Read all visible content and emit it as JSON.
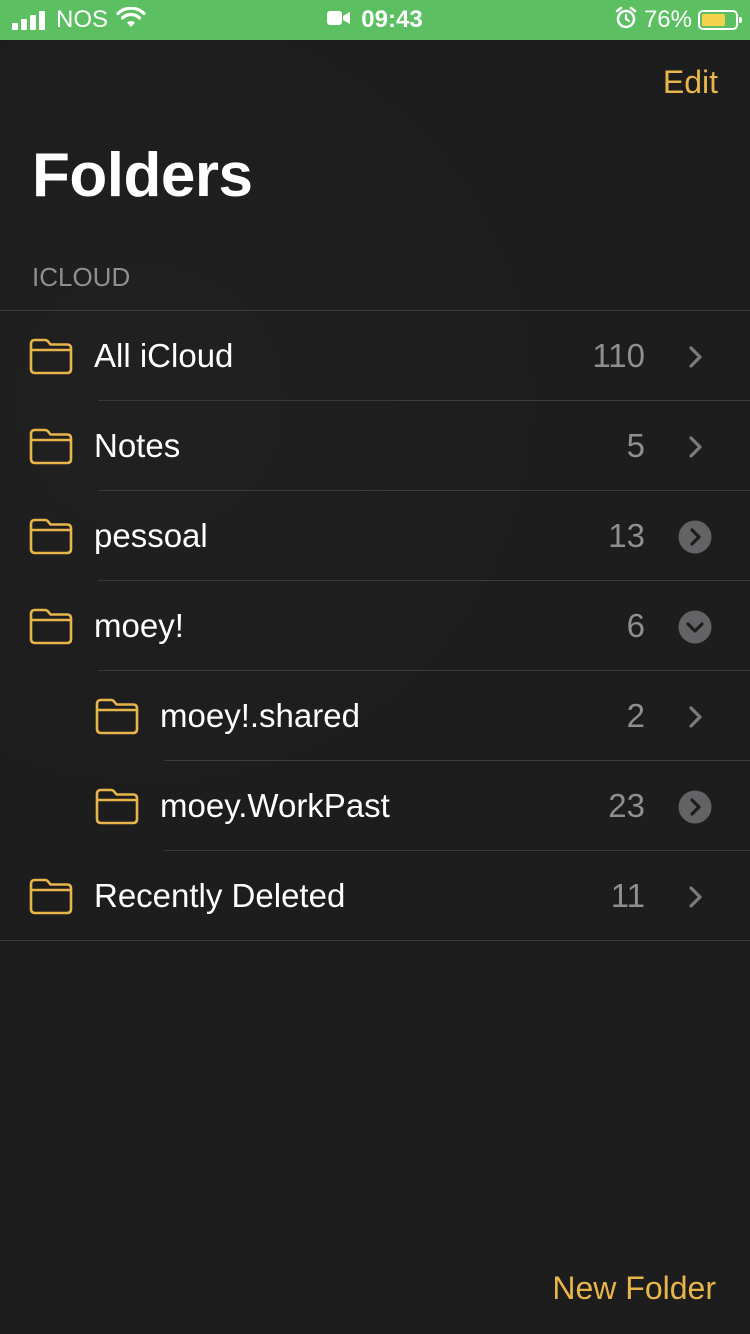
{
  "status_bar": {
    "carrier": "NOS",
    "time": "09:43",
    "battery_percent": "76%",
    "battery_level": 0.76,
    "background": "#5cbf62",
    "icons": [
      "signal-icon",
      "wifi-icon",
      "video-camera-icon",
      "alarm-icon",
      "battery-icon"
    ]
  },
  "header": {
    "edit_label": "Edit",
    "title": "Folders"
  },
  "section": {
    "title": "ICLOUD"
  },
  "folders": [
    {
      "name": "All iCloud",
      "count": "110",
      "indent": 0,
      "chevron": "plain"
    },
    {
      "name": "Notes",
      "count": "5",
      "indent": 0,
      "chevron": "plain"
    },
    {
      "name": "pessoal",
      "count": "13",
      "indent": 0,
      "chevron": "circle-right"
    },
    {
      "name": "moey!",
      "count": "6",
      "indent": 0,
      "chevron": "circle-down"
    },
    {
      "name": "moey!.shared",
      "count": "2",
      "indent": 1,
      "chevron": "plain"
    },
    {
      "name": "moey.WorkPast",
      "count": "23",
      "indent": 1,
      "chevron": "circle-right"
    },
    {
      "name": "Recently Deleted",
      "count": "11",
      "indent": 0,
      "chevron": "plain"
    }
  ],
  "footer": {
    "new_folder_label": "New Folder"
  },
  "colors": {
    "accent": "#e8b54a",
    "background": "#1d1d1d",
    "secondary_text": "#8e8e93"
  }
}
